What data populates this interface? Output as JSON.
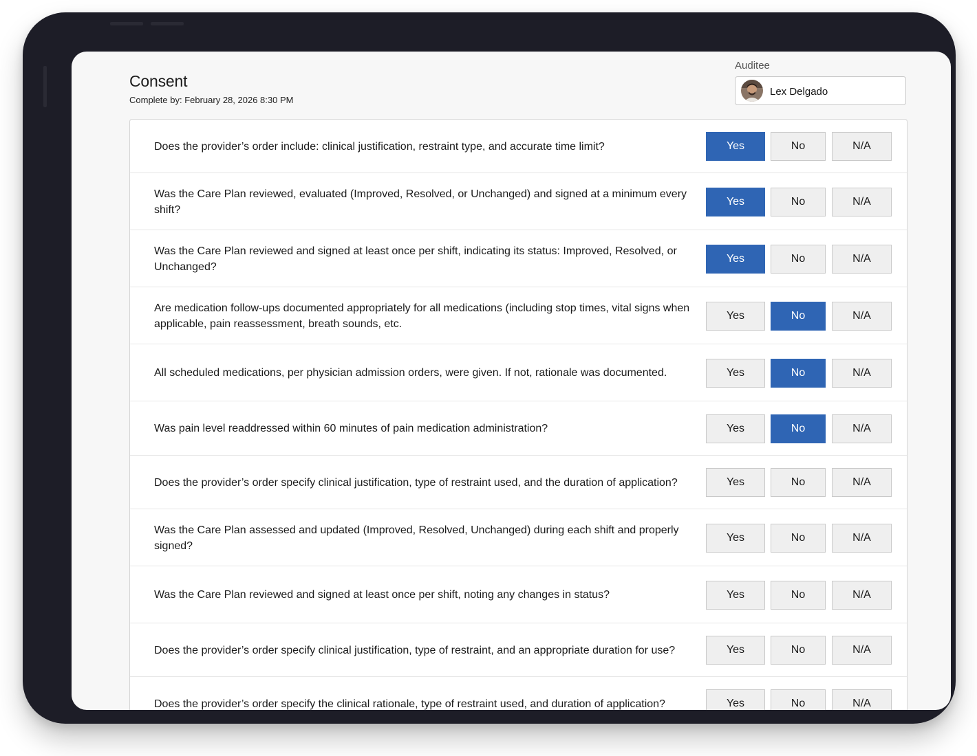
{
  "header": {
    "title": "Consent",
    "complete_by": "Complete by: February 28, 2026 8:30 PM"
  },
  "auditee": {
    "label": "Auditee",
    "name": "Lex Delgado"
  },
  "option_labels": {
    "yes": "Yes",
    "no": "No",
    "na": "N/A"
  },
  "colors": {
    "selected": "#2f65b4",
    "device_frame": "#1d1d27"
  },
  "questions": [
    {
      "text": "Does the provider’s order include: clinical justification, restraint type, and accurate time limit?",
      "answer": "Yes"
    },
    {
      "text": "Was the Care Plan reviewed, evaluated (Improved, Resolved, or Unchanged) and signed at a minimum every shift?",
      "answer": "Yes"
    },
    {
      "text": "Was the Care Plan reviewed and signed at least once per shift, indicating its status: Improved, Resolved, or Unchanged?",
      "answer": "Yes"
    },
    {
      "text": "Are medication follow-ups documented appropriately for all medications (including stop times, vital signs when applicable, pain reassessment, breath sounds, etc.",
      "answer": "No"
    },
    {
      "text": "All scheduled medications, per physician admission orders, were given. If not, rationale was documented.",
      "answer": "No"
    },
    {
      "text": "Was pain level readdressed within 60 minutes of pain medication administration?",
      "answer": "No"
    },
    {
      "text": "Does the provider’s order specify clinical justification, type of restraint used, and the duration of application?",
      "answer": ""
    },
    {
      "text": "Was the Care Plan assessed and updated (Improved, Resolved, Unchanged) during each shift and properly signed?",
      "answer": ""
    },
    {
      "text": "Was the Care Plan reviewed and signed at least once per shift, noting any changes in status?",
      "answer": ""
    },
    {
      "text": "Does the provider’s order specify clinical justification, type of restraint, and an appropriate duration for use?",
      "answer": ""
    },
    {
      "text": "Does the provider’s order specify the clinical rationale, type of restraint used, and duration of application?",
      "answer": ""
    }
  ]
}
